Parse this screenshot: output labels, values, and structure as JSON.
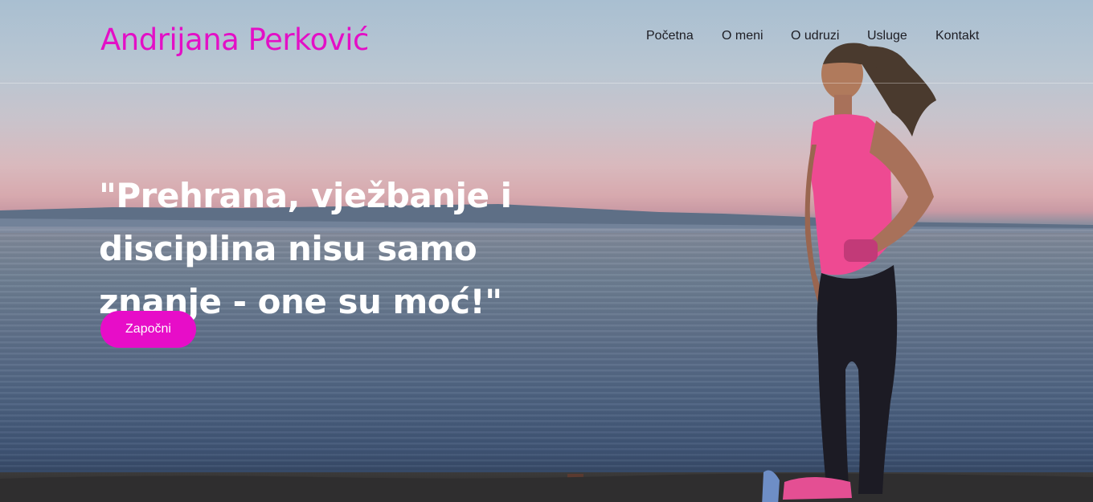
{
  "header": {
    "brand": "Andrijana Perković",
    "nav": [
      {
        "label": "Početna"
      },
      {
        "label": "O meni"
      },
      {
        "label": "O udruzi"
      },
      {
        "label": "Usluge"
      },
      {
        "label": "Kontakt"
      }
    ]
  },
  "hero": {
    "headline": "\"Prehrana, vježbanje i disciplina nisu samo znanje - one su moć!\"",
    "cta_label": "Započni",
    "background_image": "woman-by-the-sea-at-sunset"
  },
  "colors": {
    "brand": "#e30fc6",
    "cta": "#e70dc8",
    "nav_text": "#1d1d24",
    "headline": "#ffffff"
  }
}
